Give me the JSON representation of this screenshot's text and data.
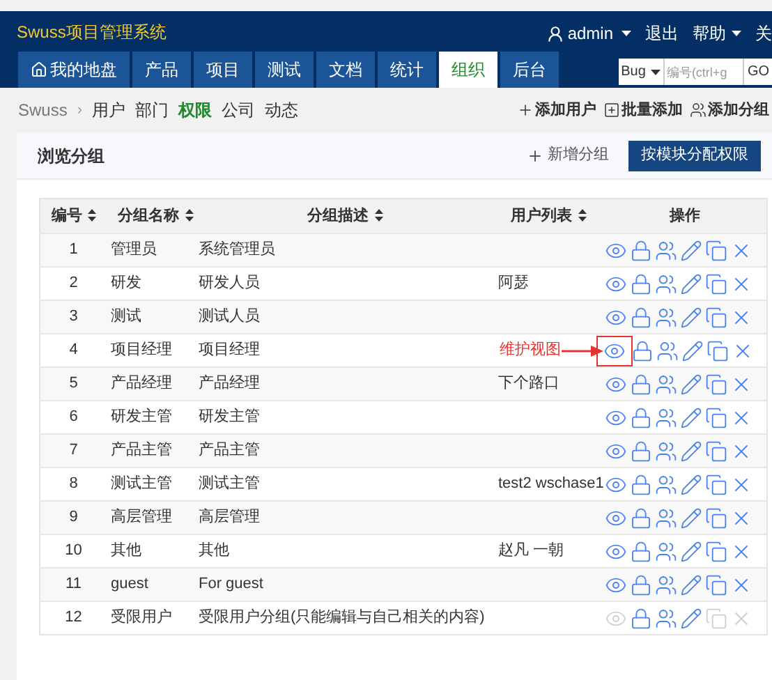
{
  "header": {
    "title": "Swuss项目管理系统",
    "user_menu": "admin",
    "links": [
      {
        "label": "退出",
        "dropdown": false
      },
      {
        "label": "帮助",
        "dropdown": true
      },
      {
        "label": "关",
        "dropdown": false
      }
    ]
  },
  "main_tabs": [
    {
      "label": "我的地盘",
      "selected": false
    },
    {
      "label": "产品",
      "selected": false
    },
    {
      "label": "项目",
      "selected": false
    },
    {
      "label": "测试",
      "selected": false
    },
    {
      "label": "文档",
      "selected": false
    },
    {
      "label": "统计",
      "selected": false
    },
    {
      "label": "组织",
      "selected": true
    },
    {
      "label": "后台",
      "selected": false
    }
  ],
  "quick_search": {
    "type": "Bug",
    "placeholder": "编号(ctrl+g",
    "button": "GO"
  },
  "breadcrumb": "Swuss",
  "breadcrumb_separator": "›",
  "sub_tabs": [
    {
      "label": "用户",
      "selected": false
    },
    {
      "label": "部门",
      "selected": false
    },
    {
      "label": "权限",
      "selected": true
    },
    {
      "label": "公司",
      "selected": false
    },
    {
      "label": "动态",
      "selected": false
    }
  ],
  "sub_actions": [
    {
      "kind": "plus",
      "label": "添加用户"
    },
    {
      "kind": "batch",
      "label": "批量添加"
    },
    {
      "kind": "group",
      "label": "添加分组"
    }
  ],
  "panel": {
    "title": "浏览分组",
    "add_link": "新增分组",
    "primary_button": "按模块分配权限"
  },
  "table": {
    "columns": [
      {
        "label": "编号",
        "sortable": true
      },
      {
        "label": "分组名称",
        "sortable": true
      },
      {
        "label": "分组描述",
        "sortable": true
      },
      {
        "label": "用户列表",
        "sortable": true
      },
      {
        "label": "操作",
        "sortable": false
      }
    ],
    "rows": [
      {
        "id": "1",
        "name": "管理员",
        "desc": "系统管理员",
        "users": "",
        "limited": false
      },
      {
        "id": "2",
        "name": "研发",
        "desc": "研发人员",
        "users": "阿瑟",
        "limited": false
      },
      {
        "id": "3",
        "name": "测试",
        "desc": "测试人员",
        "users": "",
        "limited": false
      },
      {
        "id": "4",
        "name": "项目经理",
        "desc": "项目经理",
        "users": "",
        "limited": false,
        "annotation": "维护视图"
      },
      {
        "id": "5",
        "name": "产品经理",
        "desc": "产品经理",
        "users": "下个路口",
        "limited": false
      },
      {
        "id": "6",
        "name": "研发主管",
        "desc": "研发主管",
        "users": "",
        "limited": false
      },
      {
        "id": "7",
        "name": "产品主管",
        "desc": "产品主管",
        "users": "",
        "limited": false
      },
      {
        "id": "8",
        "name": "测试主管",
        "desc": "测试主管",
        "users": "test2 wschase1",
        "limited": false
      },
      {
        "id": "9",
        "name": "高层管理",
        "desc": "高层管理",
        "users": "",
        "limited": false
      },
      {
        "id": "10",
        "name": "其他",
        "desc": "其他",
        "users": "赵凡 一朝",
        "limited": false
      },
      {
        "id": "11",
        "name": "guest",
        "desc": "For guest",
        "users": "",
        "limited": false
      },
      {
        "id": "12",
        "name": "受限用户",
        "desc": "受限用户分组(只能编辑与自己相关的内容)",
        "users": "",
        "limited": true
      }
    ]
  }
}
